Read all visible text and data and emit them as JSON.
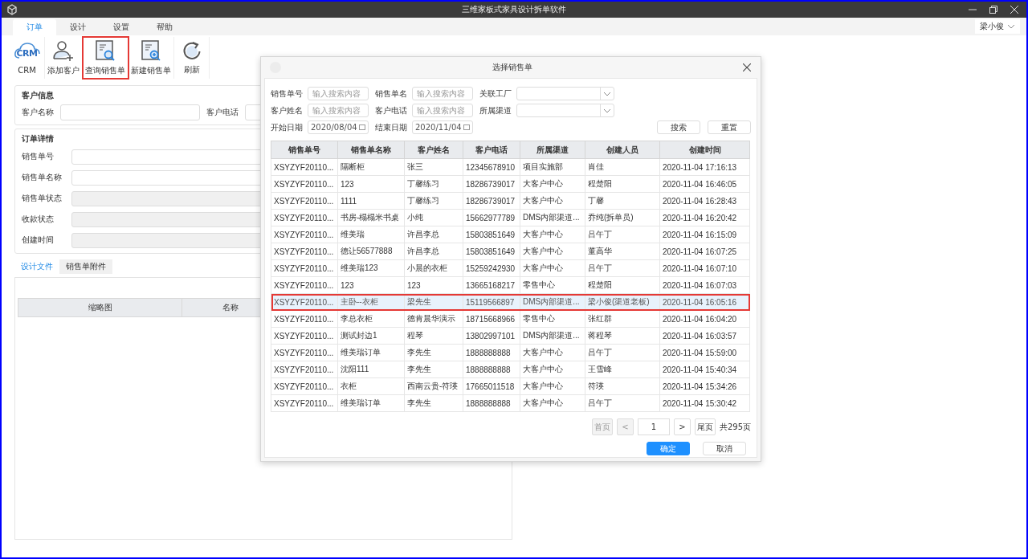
{
  "window": {
    "title": "三维家板式家具设计拆单软件"
  },
  "menu_tabs": [
    {
      "label": "订单",
      "selected": true
    },
    {
      "label": "设计",
      "selected": false
    },
    {
      "label": "设置",
      "selected": false
    },
    {
      "label": "帮助",
      "selected": false
    }
  ],
  "user": {
    "name": "梁小俊"
  },
  "toolbar": [
    {
      "label": "CRM",
      "kind": "crm",
      "logo_text": "CRM",
      "highlighted": false
    },
    {
      "label": "添加客户",
      "kind": "add-user",
      "highlighted": false
    },
    {
      "label": "查询销售单",
      "kind": "search-doc",
      "highlighted": true
    },
    {
      "label": "新建销售单",
      "kind": "new-doc",
      "highlighted": false
    },
    {
      "label": "刷新",
      "kind": "refresh",
      "highlighted": false
    }
  ],
  "customer_info": {
    "title": "客户信息",
    "fields": [
      {
        "label": "客户名称"
      },
      {
        "label": "客户电话"
      }
    ]
  },
  "order_details": {
    "title": "订单详情",
    "fields": [
      {
        "label": "销售单号",
        "disabled": false
      },
      {
        "label": "销售单名称",
        "disabled": false
      },
      {
        "label": "销售单状态",
        "disabled": true
      },
      {
        "label": "收款状态",
        "disabled": true
      },
      {
        "label": "创建时间",
        "disabled": true
      }
    ]
  },
  "file_tabs": [
    {
      "label": "设计文件",
      "selected": true
    },
    {
      "label": "销售单附件",
      "selected": false
    }
  ],
  "file_table": {
    "columns": [
      "缩略图",
      "名称"
    ]
  },
  "dialog": {
    "title": "选择销售单",
    "filters": [
      {
        "label": "销售单号",
        "kind": "text",
        "placeholder": "输入搜索内容"
      },
      {
        "label": "销售单名",
        "kind": "text",
        "placeholder": "输入搜索内容"
      },
      {
        "label": "关联工厂",
        "kind": "select"
      },
      {
        "label": "客户姓名",
        "kind": "text",
        "placeholder": "输入搜索内容"
      },
      {
        "label": "客户电话",
        "kind": "text",
        "placeholder": "输入搜索内容"
      },
      {
        "label": "所属渠道",
        "kind": "select"
      },
      {
        "label": "开始日期",
        "kind": "date",
        "value": "2020/08/04"
      },
      {
        "label": "结束日期",
        "kind": "date",
        "value": "2020/11/04"
      }
    ],
    "buttons": [
      "搜索",
      "重置"
    ],
    "columns": [
      "销售单号",
      "销售单名称",
      "客户姓名",
      "客户电话",
      "所属渠道",
      "创建人员",
      "创建时间"
    ],
    "rows": [
      {
        "cells": [
          "XSYZYF20110...",
          "隔断柜",
          "张三",
          "12345678910",
          "项目实施部",
          "肖佳",
          "2020-11-04 17:16:13"
        ],
        "selected": false,
        "highlighted": false
      },
      {
        "cells": [
          "XSYZYF20110...",
          "123",
          "丁馨练习",
          "18286739017",
          "大客户中心",
          "程楚阳",
          "2020-11-04 16:46:05"
        ],
        "selected": false,
        "highlighted": false
      },
      {
        "cells": [
          "XSYZYF20110...",
          "1111",
          "丁馨练习",
          "18286739017",
          "大客户中心",
          "丁馨",
          "2020-11-04 16:28:43"
        ],
        "selected": false,
        "highlighted": false
      },
      {
        "cells": [
          "XSYZYF20110...",
          "书房-榻榻米书桌",
          "小纯",
          "15662977789",
          "DMS内部渠道...",
          "乔纯(拆单员)",
          "2020-11-04 16:20:42"
        ],
        "selected": false,
        "highlighted": false
      },
      {
        "cells": [
          "XSYZYF20110...",
          "维美瑞",
          "许昌李总",
          "15803851649",
          "大客户中心",
          "吕午丁",
          "2020-11-04 16:15:09"
        ],
        "selected": false,
        "highlighted": false
      },
      {
        "cells": [
          "XSYZYF20110...",
          "德让56577888",
          "许昌李总",
          "15803851649",
          "大客户中心",
          "董高华",
          "2020-11-04 16:07:25"
        ],
        "selected": false,
        "highlighted": false
      },
      {
        "cells": [
          "XSYZYF20110...",
          "维美瑞123",
          "小晨的衣柜",
          "15259242930",
          "大客户中心",
          "吕午丁",
          "2020-11-04 16:07:10"
        ],
        "selected": false,
        "highlighted": false
      },
      {
        "cells": [
          "XSYZYF20110...",
          "123",
          "123",
          "13665168217",
          "零售中心",
          "程楚阳",
          "2020-11-04 16:07:03"
        ],
        "selected": false,
        "highlighted": false
      },
      {
        "cells": [
          "XSYZYF20110...",
          "主卧--衣柜",
          "梁先生",
          "15119566897",
          "DMS内部渠道...",
          "梁小俊(渠道老板)",
          "2020-11-04 16:05:16"
        ],
        "selected": true,
        "highlighted": true
      },
      {
        "cells": [
          "XSYZYF20110...",
          "李总衣柜",
          "德肯晨华演示",
          "18715668966",
          "零售中心",
          "张红群",
          "2020-11-04 16:04:20"
        ],
        "selected": false,
        "highlighted": false
      },
      {
        "cells": [
          "XSYZYF20110...",
          "测试封边1",
          "程琴",
          "13802997101",
          "DMS内部渠道...",
          "蒋程琴",
          "2020-11-04 16:03:57"
        ],
        "selected": false,
        "highlighted": false
      },
      {
        "cells": [
          "XSYZYF20110...",
          "维美瑞订单",
          "李先生",
          "1888888888",
          "大客户中心",
          "吕午丁",
          "2020-11-04 15:59:00"
        ],
        "selected": false,
        "highlighted": false
      },
      {
        "cells": [
          "XSYZYF20110...",
          "沈阳111",
          "李先生",
          "1888888888",
          "大客户中心",
          "王雪峰",
          "2020-11-04 15:40:34"
        ],
        "selected": false,
        "highlighted": false
      },
      {
        "cells": [
          "XSYZYF20110...",
          "衣柜",
          "西南云贵-符瑛",
          "17665011518",
          "大客户中心",
          "符瑛",
          "2020-11-04 15:34:26"
        ],
        "selected": false,
        "highlighted": false
      },
      {
        "cells": [
          "XSYZYF20110...",
          "维美瑞订单",
          "李先生",
          "1888888888",
          "大客户中心",
          "吕午丁",
          "2020-11-04 15:30:42"
        ],
        "selected": false,
        "highlighted": false
      }
    ],
    "pagination": {
      "first": "首页",
      "prev": "<",
      "page": "1",
      "next": ">",
      "last": "尾页",
      "total": "共295页"
    },
    "actions": [
      {
        "label": "确定",
        "primary": true
      },
      {
        "label": "取消",
        "primary": false
      }
    ]
  }
}
